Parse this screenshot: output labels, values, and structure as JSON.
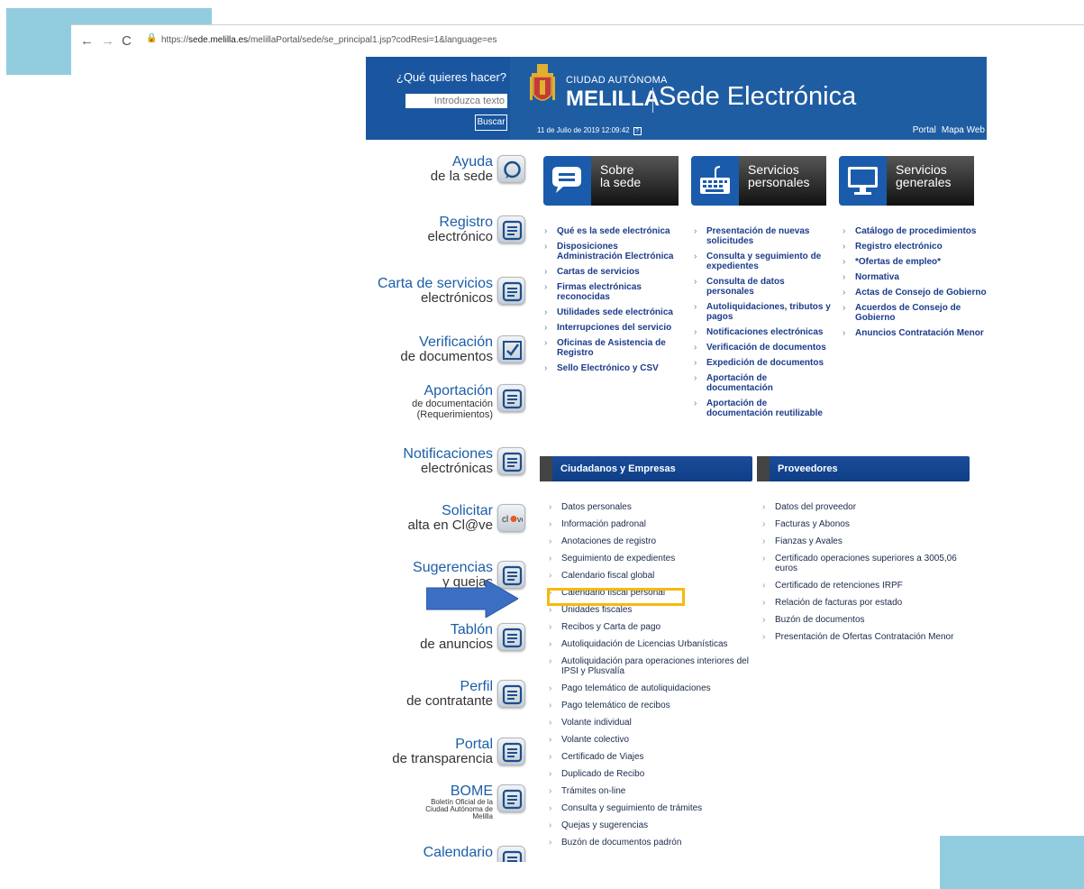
{
  "browser": {
    "url_prefix": "https://",
    "url_domain": "sede.melilla.es",
    "url_path": "/melillaPortal/sede/se_principal1.jsp?codResi=1&language=es"
  },
  "header": {
    "question": "¿Qué quieres hacer?",
    "search_placeholder": "Introduzca texto",
    "search_button": "Buscar",
    "ciudad": "CIUDAD AUTÓNOMA",
    "melilla": "MELILLA",
    "sede": "Sede Electrónica",
    "date": "11 de Julio de 2019 12:09:42",
    "portal": "Portal",
    "mapa": "Mapa Web"
  },
  "sidebar": [
    {
      "big": "Ayuda",
      "small": "de la sede",
      "icon": "chat-bubble-icon"
    },
    {
      "big": "Registro",
      "small": "electrónico",
      "icon": "monitor-form-icon"
    },
    {
      "big": "Carta de servicios",
      "small": "electrónicos",
      "icon": "books-icon"
    },
    {
      "big": "Verificación",
      "small": "de documentos",
      "icon": "checkbox-icon"
    },
    {
      "big": "Aportación",
      "small": "de documentación",
      "extra": "(Requerimientos)",
      "icon": "monitor-form-icon"
    },
    {
      "big": "Notificaciones",
      "small": "electrónicas",
      "icon": "list-icon"
    },
    {
      "big": "Solicitar",
      "small": "alta en Cl@ve",
      "icon": "clave-icon"
    },
    {
      "big": "Sugerencias",
      "small": "y quejas",
      "icon": "envelope-icon"
    },
    {
      "big": "Tablón",
      "small": "de anuncios",
      "icon": "notice-board-icon"
    },
    {
      "big": "Perfil",
      "small": "de contratante",
      "icon": "people-icon"
    },
    {
      "big": "Portal",
      "small": "de transparencia",
      "icon": "magnifier-doc-icon"
    },
    {
      "big": "BOME",
      "small": "Boletín Oficial de la Ciudad Autónoma de Melilla",
      "icon": "book-icon"
    },
    {
      "big": "Calendario",
      "small": "",
      "icon": "calendar-icon"
    }
  ],
  "categories": [
    {
      "line1": "Sobre",
      "line2": "la sede"
    },
    {
      "line1": "Servicios",
      "line2": "personales"
    },
    {
      "line1": "Servicios",
      "line2": "generales"
    }
  ],
  "col1": [
    "Qué es la sede electrónica",
    "Disposiciones Administración Electrónica",
    "Cartas de servicios",
    "Firmas electrónicas reconocidas",
    "Utilidades sede electrónica",
    "Interrupciones del servicio",
    "Oficinas de Asistencia de Registro",
    "Sello Electrónico y CSV"
  ],
  "col2": [
    "Presentación de nuevas solicitudes",
    "Consulta y seguimiento de expedientes",
    "Consulta de datos personales",
    "Autoliquidaciones, tributos y pagos",
    "Notificaciones electrónicas",
    "Verificación de documentos",
    "Expedición de documentos",
    "Aportación de documentación",
    "Aportación de documentación reutilizable"
  ],
  "col3": [
    "Catálogo de procedimientos",
    "Registro electrónico",
    "*Ofertas de empleo*",
    "Normativa",
    "Actas de Consejo de Gobierno",
    "Acuerdos de Consejo de Gobierno",
    "Anuncios Contratación Menor"
  ],
  "bars": {
    "ciudadanos": "Ciudadanos y Empresas",
    "proveedores": "Proveedores"
  },
  "ciudadanos_list": [
    "Datos personales",
    "Información padronal",
    "Anotaciones de registro",
    "Seguimiento de expedientes",
    "Calendario fiscal global",
    "Calendario fiscal personal",
    "Unidades fiscales",
    "Recibos y Carta de pago",
    "Autoliquidación de Licencias Urbanísticas",
    "Autoliquidación para operaciones interiores del IPSI y Plusvalía",
    "Pago telemático de autoliquidaciones",
    "Pago telemático de recibos",
    "Volante individual",
    "Volante colectivo",
    "Certificado de Viajes",
    "Duplicado de Recibo",
    "Trámites on-line",
    "Consulta y seguimiento de trámites",
    "Quejas y sugerencias",
    "Buzón de documentos padrón"
  ],
  "proveedores_list": [
    "Datos del proveedor",
    "Facturas y Abonos",
    "Fianzas y Avales",
    "Certificado operaciones superiores a 3005,06 euros",
    "Certificado de retenciones IRPF",
    "Relación de facturas por estado",
    "Buzón de documentos",
    "Presentación de Ofertas Contratación Menor"
  ],
  "colors": {
    "header_blue": "#1f5da2",
    "highlight": "#f6b90d",
    "arrow": "#3b6fc4",
    "deco": "#92cddf"
  }
}
